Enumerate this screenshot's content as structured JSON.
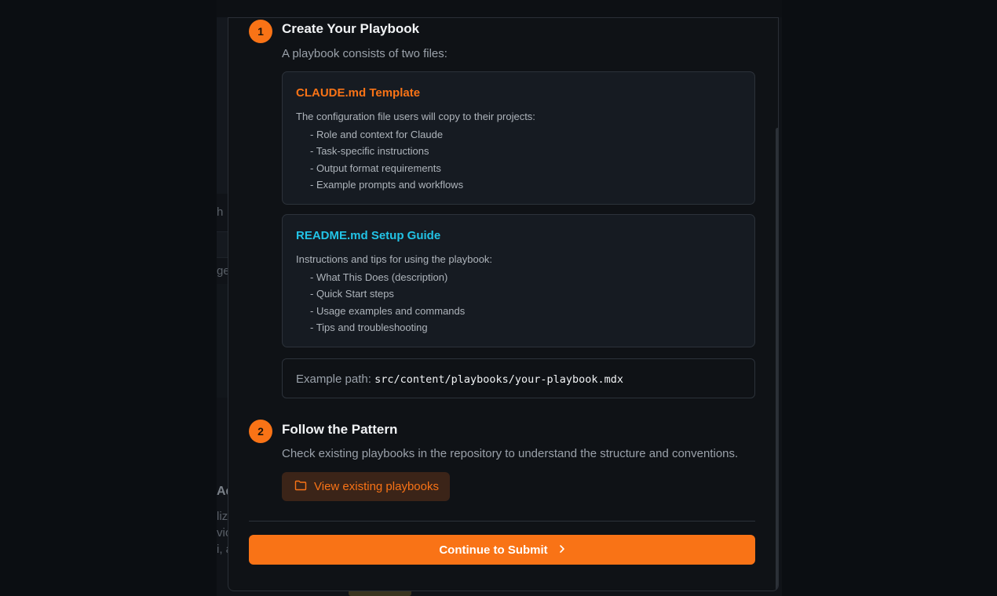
{
  "background": {
    "fragments": [
      "h",
      "ge",
      "Ad",
      "liz",
      "vio",
      "i, a"
    ]
  },
  "steps": [
    {
      "number": "1",
      "title": "Create Your Playbook",
      "description": "A playbook consists of two files:"
    },
    {
      "number": "2",
      "title": "Follow the Pattern",
      "description": "Check existing playbooks in the repository to understand the structure and conventions."
    }
  ],
  "cards": [
    {
      "title": "CLAUDE.md Template",
      "title_color": "#f97316",
      "description": "The configuration file users will copy to their projects:",
      "items": [
        "- Role and context for Claude",
        "- Task-specific instructions",
        "- Output format requirements",
        "- Example prompts and workflows"
      ]
    },
    {
      "title": "README.md Setup Guide",
      "title_color": "#22c3e6",
      "description": "Instructions and tips for using the playbook:",
      "items": [
        "- What This Does (description)",
        "- Quick Start steps",
        "- Usage examples and commands",
        "- Tips and troubleshooting"
      ]
    }
  ],
  "example_path": {
    "label": "Example path:",
    "path": "src/content/playbooks/your-playbook.mdx"
  },
  "view_button": {
    "label": "View existing playbooks",
    "icon": "folder-icon"
  },
  "continue_button": {
    "label": "Continue to Submit",
    "icon": "chevron-right-icon"
  },
  "colors": {
    "accent": "#f97316",
    "secondary": "#22c3e6",
    "modal_bg": "#0f1216",
    "card_bg": "#161b22"
  }
}
